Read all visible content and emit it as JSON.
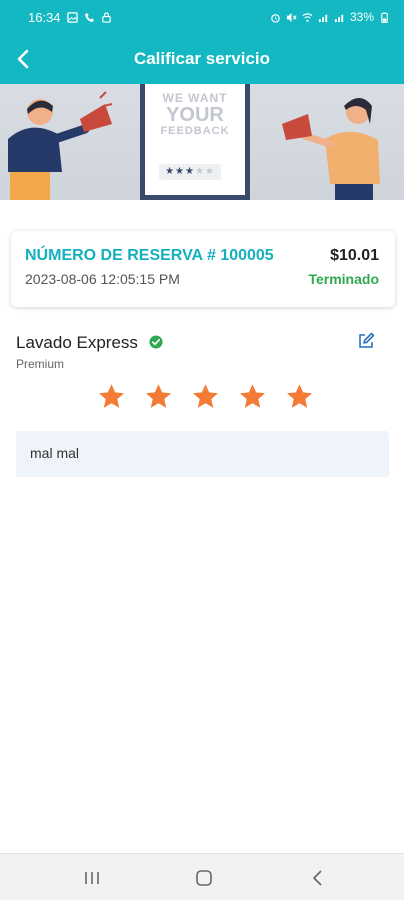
{
  "status_bar": {
    "time": "16:34",
    "battery": "33%"
  },
  "header": {
    "title": "Calificar servicio"
  },
  "banner": {
    "line1": "WE WANT",
    "line2": "YOUR",
    "line3": "FEEDBACK"
  },
  "booking": {
    "number_label": "NÚMERO DE RESERVA # 100005",
    "price": "$10.01",
    "datetime": "2023-08-06 12:05:15 PM",
    "status": "Terminado"
  },
  "service": {
    "name": "Lavado Express",
    "tier": "Premium"
  },
  "rating": {
    "value": 5,
    "max": 5
  },
  "comment": {
    "text": "mal mal"
  },
  "colors": {
    "accent": "#13b8c2",
    "star": "#f47b35",
    "status_done": "#2fa84f",
    "verified": "#2fa84f"
  },
  "icons": [
    "back-arrow-icon",
    "verified-icon",
    "edit-icon",
    "star-icon",
    "recent-apps-icon",
    "home-icon",
    "nav-back-icon"
  ]
}
